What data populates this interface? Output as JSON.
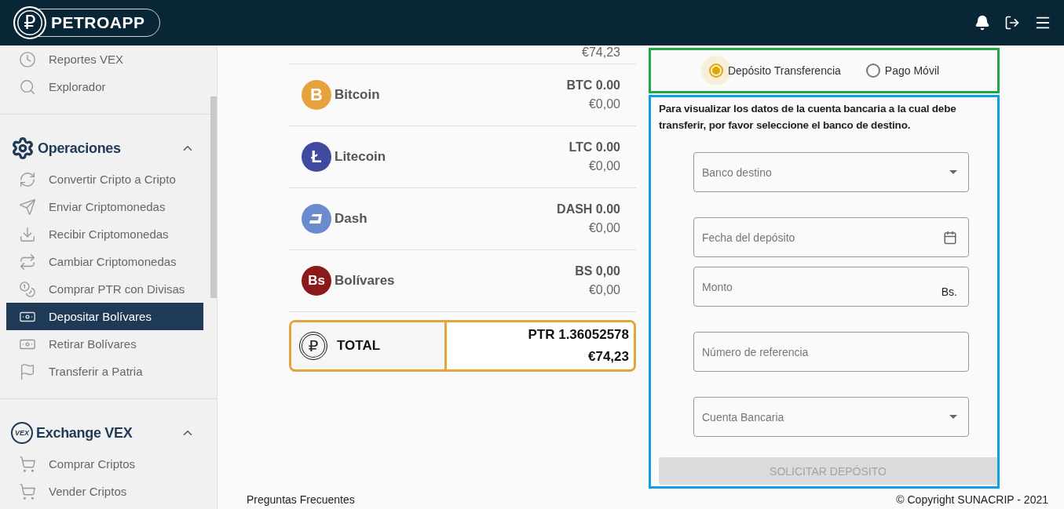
{
  "header": {
    "logo_symbol": "₽",
    "logo_text": "PETROAPP"
  },
  "sidebar": {
    "sections": [
      {
        "items": [
          {
            "label": "Reportes VEX",
            "selected": false
          },
          {
            "label": "Explorador",
            "selected": false
          }
        ]
      },
      {
        "title": "Operaciones",
        "expanded": true,
        "items": [
          {
            "label": "Convertir Cripto a Cripto",
            "selected": false
          },
          {
            "label": "Enviar Criptomonedas",
            "selected": false
          },
          {
            "label": "Recibir Criptomonedas",
            "selected": false
          },
          {
            "label": "Cambiar Criptomonedas",
            "selected": false
          },
          {
            "label": "Comprar PTR con Divisas",
            "selected": false
          },
          {
            "label": "Depositar Bolívares",
            "selected": true
          },
          {
            "label": "Retirar Bolívares",
            "selected": false
          },
          {
            "label": "Transferir a Patria",
            "selected": false
          }
        ]
      },
      {
        "title": "Exchange VEX",
        "badge": "VEX",
        "expanded": true,
        "items": [
          {
            "label": "Comprar Criptos",
            "selected": false
          },
          {
            "label": "Vender Criptos",
            "selected": false
          }
        ]
      }
    ]
  },
  "balances": {
    "partial_row": {
      "fiat": "€74,23"
    },
    "rows": [
      {
        "name": "Bitcoin",
        "symbol": "B",
        "color": "#e6a23c",
        "amount": "BTC 0.00",
        "fiat": "€0,00"
      },
      {
        "name": "Litecoin",
        "symbol": "Ł",
        "color": "#3f4aa0",
        "amount": "LTC 0.00",
        "fiat": "€0,00"
      },
      {
        "name": "Dash",
        "symbol": null,
        "color": "#6b8bcf",
        "amount": "DASH 0.00",
        "fiat": "€0,00"
      },
      {
        "name": "Bolívares",
        "symbol": "Bs",
        "color": "#8b1a1a",
        "amount": "BS 0,00",
        "fiat": "€0,00"
      }
    ],
    "total": {
      "symbol": "₽",
      "label": "TOTAL",
      "amount": "PTR 1.36052578",
      "fiat": "€74,23"
    }
  },
  "deposit": {
    "methods": [
      {
        "label": "Depósito Transferencia",
        "selected": true
      },
      {
        "label": "Pago Móvil",
        "selected": false
      }
    ],
    "instructions": "Para visualizar los datos de la cuenta bancaria a la cual debe transferir, por favor seleccione el banco de destino.",
    "fields": [
      {
        "kind": "select",
        "placeholder": "Banco destino"
      },
      {
        "kind": "date",
        "placeholder": "Fecha del depósito"
      },
      {
        "kind": "amount",
        "placeholder": "Monto",
        "suffix": "Bs."
      },
      {
        "kind": "text",
        "placeholder": "Número de referencia"
      },
      {
        "kind": "select",
        "placeholder": "Cuenta Bancaria"
      }
    ],
    "submit": {
      "label": "SOLICITAR DEPÓSITO",
      "disabled": true
    }
  },
  "footer": {
    "left": "Preguntas Frecuentes",
    "right": "© Copyright SUNACRIP - 2021"
  }
}
